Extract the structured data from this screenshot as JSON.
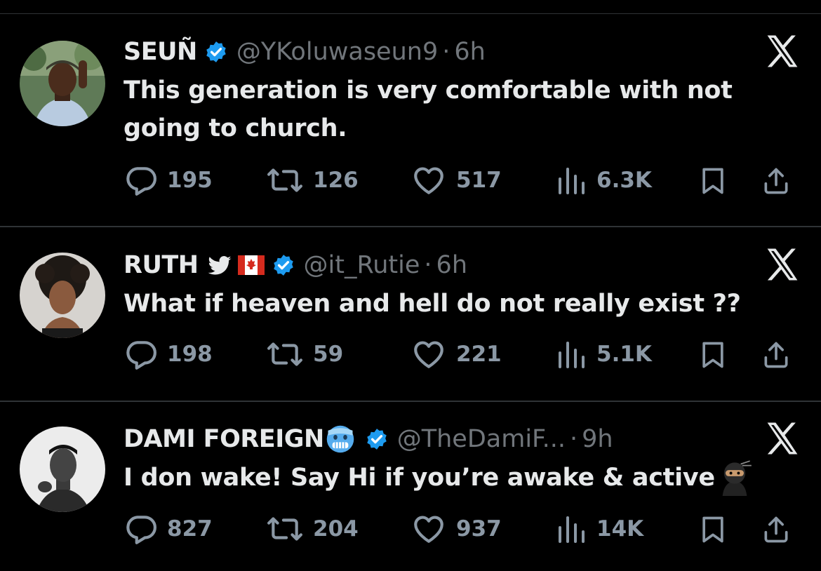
{
  "tweets": [
    {
      "name": "SEUÑ",
      "handle": "@YKoluwaseun9",
      "separator": "·",
      "time": "6h",
      "text": "This generation is very comfortable with not going to church.",
      "replies": "195",
      "reposts": "126",
      "likes": "517",
      "views": "6.3K"
    },
    {
      "name": "RUTH",
      "handle": "@it_Rutie",
      "separator": "·",
      "time": "6h",
      "text": "What if heaven and hell do not really exist ??",
      "replies": "198",
      "reposts": "59",
      "likes": "221",
      "views": "5.1K"
    },
    {
      "name": "DAMI FOREIGN",
      "handle": "@TheDamiF...",
      "separator": "·",
      "time": "9h",
      "text": "I don wake! Say Hi if you’re awake & active",
      "replies": "827",
      "reposts": "204",
      "likes": "937",
      "views": "14K"
    }
  ],
  "colors": {
    "background": "#000000",
    "text": "#e7e9ea",
    "muted": "#71767b",
    "icon": "#8b98a5",
    "verified": "#1d9bf0",
    "divider": "#2f3336"
  },
  "icons": {
    "reply": "speech-bubble-icon",
    "repost": "repost-arrows-icon",
    "like": "heart-icon",
    "views": "bar-chart-icon",
    "bookmark": "bookmark-icon",
    "share": "share-upload-icon",
    "brand": "x-logo-icon",
    "verified": "verified-badge-icon"
  }
}
